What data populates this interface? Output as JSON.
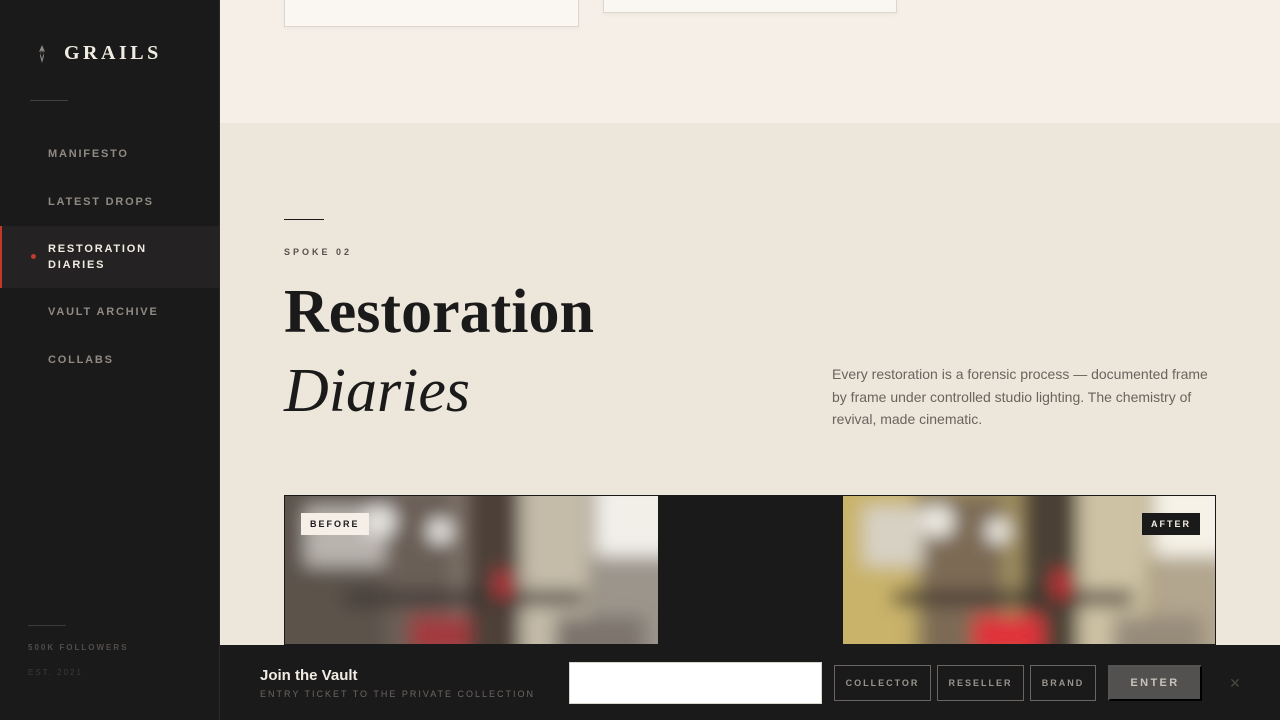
{
  "sidebar": {
    "brand": "GRAILS",
    "nav": [
      {
        "label": "MANIFESTO",
        "active": false
      },
      {
        "label": "LATEST DROPS",
        "active": false
      },
      {
        "label": "RESTORATION DIARIES",
        "active": true
      },
      {
        "label": "VAULT ARCHIVE",
        "active": false
      },
      {
        "label": "COLLABS",
        "active": false
      }
    ],
    "followers": "500K FOLLOWERS",
    "est": "EST. 2021"
  },
  "section": {
    "kicker": "SPOKE 02",
    "title_line1": "Restoration",
    "title_line2": "Diaries",
    "description": "Every restoration is a forensic process — documented frame by frame under controlled studio lighting. The chemistry of revival, made cinematic."
  },
  "comparison": {
    "before_label": "BEFORE",
    "after_label": "AFTER"
  },
  "vault": {
    "title": "Join the Vault",
    "subtitle": "ENTRY TICKET TO THE PRIVATE COLLECTION",
    "input_value": "",
    "segments": [
      "COLLECTOR",
      "RESELLER",
      "BRAND"
    ],
    "enter_label": "ENTER",
    "close_glyph": "✕"
  },
  "colors": {
    "accent": "#c0392b",
    "sidebar_bg": "#1b1a1a",
    "page_bg": "#ece6db"
  }
}
